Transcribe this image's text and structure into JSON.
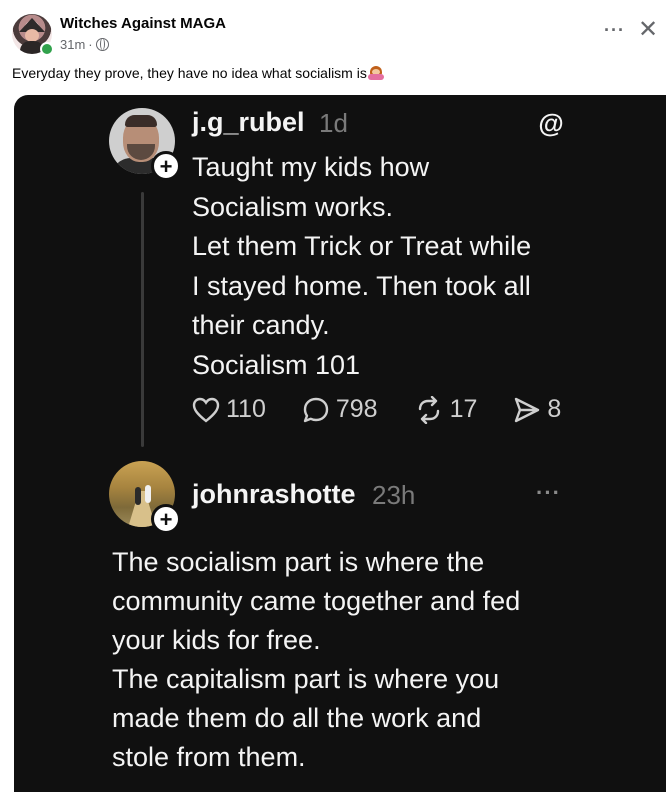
{
  "post": {
    "author": "Witches Against MAGA",
    "time": "31m",
    "separator": "·",
    "caption": "Everyday they prove, they have no idea what socialism is",
    "more_label": "···",
    "close_label": "✕"
  },
  "screenshot": {
    "original": {
      "username": "j.g_rubel",
      "time": "1d",
      "lines": [
        "Taught my kids how",
        "Socialism works.",
        "Let them Trick or Treat while",
        "I stayed home. Then took all",
        "their candy.",
        "Socialism 101"
      ],
      "likes": "110",
      "comments": "798",
      "reposts": "17",
      "shares": "8"
    },
    "reply": {
      "username": "johnrashotte",
      "time": "23h",
      "more_label": "···",
      "lines": [
        "The socialism part is where the",
        "community came together and fed",
        "your kids for free.",
        "The capitalism part is where you",
        "made them do all the work and",
        "stole from them."
      ]
    },
    "plus_label": "+",
    "threads_logo_char": "@"
  },
  "icons": {
    "emoji": "woman-gesturing-no-emoji",
    "globe": "globe-icon",
    "like": "heart-icon",
    "comment": "comment-bubble-icon",
    "repost": "repost-icon",
    "share": "send-icon"
  }
}
